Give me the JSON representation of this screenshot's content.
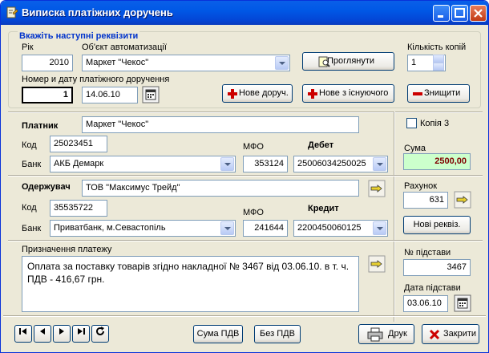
{
  "window": {
    "title": "Виписка платіжних доручень"
  },
  "section_header": "Вкажіть наступні реквізити",
  "year": {
    "label": "Рік",
    "value": "2010"
  },
  "object": {
    "label": "Об'єкт автоматизації",
    "value": "Маркет \"Чекос\""
  },
  "view_button": "Проглянути",
  "copies": {
    "label": "Кількість копій",
    "value": "1"
  },
  "doc_number": {
    "label": "Номер и дату платіжного доручення",
    "number": "1",
    "date": "14.06.10"
  },
  "new_doc_button": "Нове доруч.",
  "new_from_existing_button": "Нове з існуючого",
  "delete_button": "Знищити",
  "payer": {
    "label": "Платник",
    "name": "Маркет \"Чекос\"",
    "code_label": "Код",
    "code": "25023451",
    "bank_label": "Банк",
    "bank": "АКБ Демарк",
    "mfo_label": "МФО",
    "mfo": "353124",
    "account_label": "Дебет",
    "account": "25006034250025"
  },
  "copy3": {
    "label": "Копія 3"
  },
  "sum": {
    "label": "Сума",
    "value": "2500,00"
  },
  "receiver": {
    "label": "Одержувач",
    "name": "ТОВ \"Максимус Трейд\"",
    "code_label": "Код",
    "code": "35535722",
    "bank_label": "Банк",
    "bank": "Приватбанк, м.Севастопіль",
    "mfo_label": "МФО",
    "mfo": "241644",
    "account_label": "Кредит",
    "account": "2200450060125"
  },
  "account": {
    "label": "Рахунок",
    "value": "631"
  },
  "new_details_button": "Нові реквіз.",
  "purpose": {
    "label": "Призначення платежу",
    "text": "Оплата за поставку товарів згідно накладної № 3467 від 03.06.10.  в т. ч. ПДВ - 416,67 грн."
  },
  "basis_no": {
    "label": "№ підстави",
    "value": "3467"
  },
  "basis_date": {
    "label": "Дата підстави",
    "value": "03.06.10"
  },
  "bottom": {
    "vat_sum_button": "Сума ПДВ",
    "no_vat_button": "Без ПДВ",
    "print_button": "Друк",
    "close_button": "Закрити"
  },
  "colors": {
    "title_bar": "#0058e6",
    "accent_red": "#cc0000",
    "sum_bg": "#ccffcc",
    "sum_text": "#800000",
    "header_blue": "#0033cc"
  }
}
